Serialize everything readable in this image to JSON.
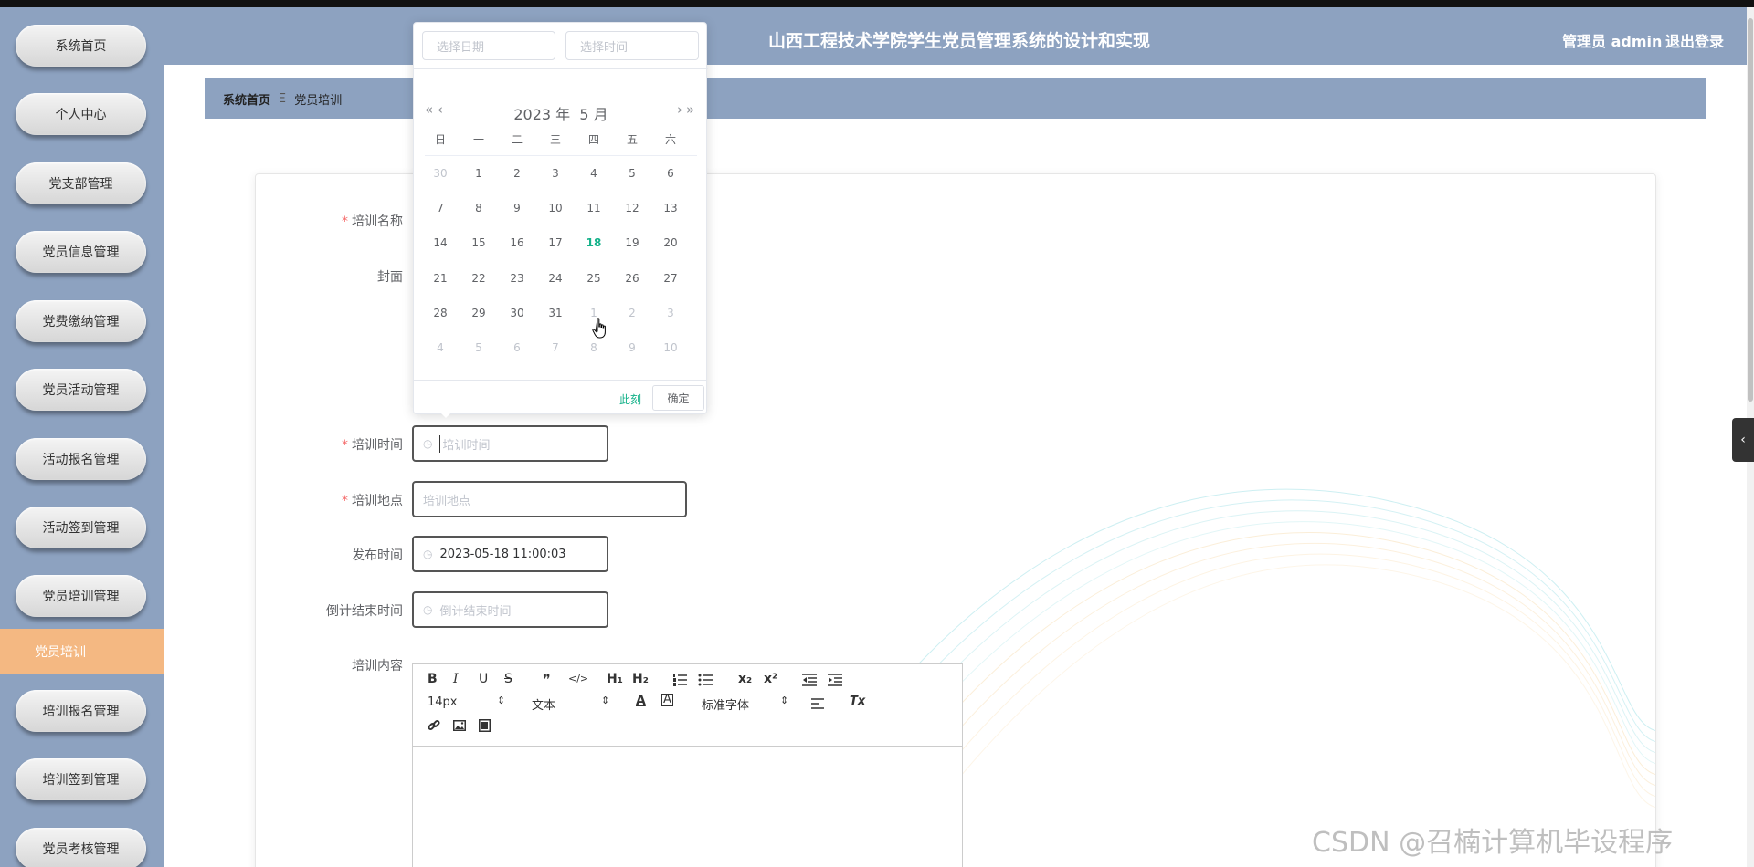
{
  "app": {
    "title": "山西工程技术学院学生党员管理系统的设计和实现",
    "user_label": "管理员 admin",
    "logout_label": "退出登录"
  },
  "sidebar": {
    "items": [
      {
        "label": "系统首页"
      },
      {
        "label": "个人中心"
      },
      {
        "label": "党支部管理"
      },
      {
        "label": "党员信息管理"
      },
      {
        "label": "党费缴纳管理"
      },
      {
        "label": "党员活动管理"
      },
      {
        "label": "活动报名管理"
      },
      {
        "label": "活动签到管理"
      },
      {
        "label": "党员培训管理"
      },
      {
        "label": "党员培训"
      },
      {
        "label": "培训报名管理"
      },
      {
        "label": "培训签到管理"
      },
      {
        "label": "党员考核管理"
      }
    ],
    "active_index": 9
  },
  "breadcrumb": {
    "home": "系统首页",
    "separator": "Ξ",
    "current": "党员培训"
  },
  "form": {
    "fields": {
      "name": {
        "label": "培训名称",
        "required": true
      },
      "cover": {
        "label": "封面",
        "required": false
      },
      "time": {
        "label": "培训时间",
        "required": true,
        "placeholder": "培训时间"
      },
      "place": {
        "label": "培训地点",
        "required": true,
        "placeholder": "培训地点"
      },
      "publish": {
        "label": "发布时间",
        "required": false,
        "value": "2023-05-18 11:00:03"
      },
      "countdown": {
        "label": "倒计结束时间",
        "required": false,
        "placeholder": "倒计结束时间"
      },
      "content": {
        "label": "培训内容",
        "required": false
      }
    }
  },
  "editor": {
    "font_size": "14px",
    "paragraph": "文本",
    "font_family": "标准字体",
    "buttons": [
      "bold",
      "italic",
      "underline",
      "strike",
      "blockquote",
      "code-block",
      "header-1",
      "header-2",
      "ordered-list",
      "bullet-list",
      "subscript",
      "superscript",
      "indent-decrease",
      "indent-increase",
      "font-color",
      "background-color",
      "align",
      "clean",
      "link",
      "image",
      "video"
    ],
    "glyphs": {
      "bold": "B",
      "italic": "I",
      "underline": "U",
      "strike": "S",
      "quote": "❞",
      "code": "</>",
      "h1": "H₁",
      "h2": "H₂",
      "sub": "x₂",
      "sup": "x²",
      "color": "A",
      "bg": "A",
      "clean": "Tx"
    }
  },
  "datepicker": {
    "date_placeholder": "选择日期",
    "time_placeholder": "选择时间",
    "year_label": "2023 年",
    "month_label": "5 月",
    "weekdays": [
      "日",
      "一",
      "二",
      "三",
      "四",
      "五",
      "六"
    ],
    "weeks": [
      [
        {
          "d": "30",
          "m": true
        },
        {
          "d": "1"
        },
        {
          "d": "2"
        },
        {
          "d": "3"
        },
        {
          "d": "4"
        },
        {
          "d": "5"
        },
        {
          "d": "6"
        }
      ],
      [
        {
          "d": "7"
        },
        {
          "d": "8"
        },
        {
          "d": "9"
        },
        {
          "d": "10"
        },
        {
          "d": "11"
        },
        {
          "d": "12"
        },
        {
          "d": "13"
        }
      ],
      [
        {
          "d": "14"
        },
        {
          "d": "15"
        },
        {
          "d": "16"
        },
        {
          "d": "17"
        },
        {
          "d": "18",
          "t": true
        },
        {
          "d": "19"
        },
        {
          "d": "20"
        }
      ],
      [
        {
          "d": "21"
        },
        {
          "d": "22"
        },
        {
          "d": "23"
        },
        {
          "d": "24"
        },
        {
          "d": "25"
        },
        {
          "d": "26"
        },
        {
          "d": "27"
        }
      ],
      [
        {
          "d": "28"
        },
        {
          "d": "29"
        },
        {
          "d": "30"
        },
        {
          "d": "31"
        },
        {
          "d": "1",
          "m": true
        },
        {
          "d": "2",
          "m": true
        },
        {
          "d": "3",
          "m": true
        }
      ],
      [
        {
          "d": "4",
          "m": true
        },
        {
          "d": "5",
          "m": true
        },
        {
          "d": "6",
          "m": true
        },
        {
          "d": "7",
          "m": true
        },
        {
          "d": "8",
          "m": true
        },
        {
          "d": "9",
          "m": true
        },
        {
          "d": "10",
          "m": true
        }
      ]
    ],
    "now_label": "此刻",
    "confirm_label": "确定",
    "prev_year": "«",
    "prev_month": "‹",
    "next_month": "›",
    "next_year": "»"
  },
  "watermark": "CSDN @召楠计算机毕设程序",
  "colors": {
    "nav": "#8da2c0",
    "active": "#f4b882",
    "accent": "#15b28a",
    "required": "#f56c6c"
  },
  "icons": {
    "clock": "◷",
    "collapse": "‹"
  }
}
